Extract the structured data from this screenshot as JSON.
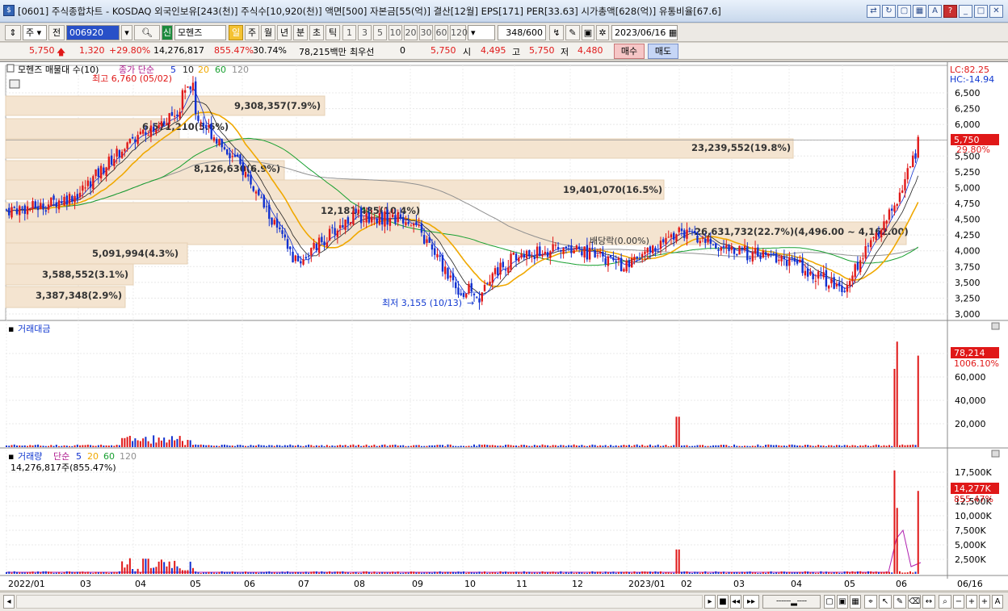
{
  "window": {
    "title": "[0601] 주식종합차트 - KOSDAQ 외국인보유[243(천)] 주식수[10,920(천)] 액면[500] 자본금[55(억)] 결산[12월] EPS[171] PER[33.63] 시가총액[628(억)] 유통비율[67.6]"
  },
  "toolbar": {
    "period_main": "주",
    "prev_label": "전",
    "code": "006920",
    "badge": "신",
    "stock_name": "모헨즈",
    "period_tabs": [
      "일",
      "주",
      "월",
      "년",
      "분",
      "초",
      "틱"
    ],
    "minutes": [
      "1",
      "3",
      "5",
      "10",
      "20",
      "30",
      "60",
      "120"
    ],
    "count": "348",
    "count_total": "/600",
    "date": "2023/06/16"
  },
  "quote": {
    "price": "5,750",
    "change": "1,320",
    "change_pct": "+29.80%",
    "volume": "14,276,817",
    "volume_ratio": "855.47%",
    "turnover": "30.74%",
    "amount": "78,215백만",
    "best_label": "최우선",
    "best_value": "0",
    "ask": "5,750",
    "open_label": "시",
    "open": "4,495",
    "high_label": "고",
    "high": "5,750",
    "low_label": "저",
    "low": "4,480",
    "buy_label": "매수",
    "sell_label": "매도"
  },
  "price_panel": {
    "legend_name": "모헨즈 매물대 수(10)",
    "ma_label": "종가 단순",
    "ma_periods": [
      "5",
      "10",
      "20",
      "60",
      "120"
    ],
    "lc": "LC:82.25",
    "hc": "HC:-14.94",
    "cur_price": "5,750",
    "cur_pct": "29.80%",
    "high_note": "최고 6,760 (05/02)",
    "low_note": "최저 3,155 (10/13)",
    "dividend_note": "배당락(0.00%)",
    "y_ticks": [
      "6,500",
      "6,250",
      "6,000",
      "5,750",
      "5,500",
      "5,250",
      "5,000",
      "4,750",
      "4,500",
      "4,250",
      "4,000",
      "3,750",
      "3,500",
      "3,250",
      "3,000"
    ],
    "profile": [
      {
        "label": "9,308,357(7.9%)"
      },
      {
        "label": "6,571,210(5.6%)"
      },
      {
        "label": "23,239,552(19.8%)"
      },
      {
        "label": "8,126,630(6.9%)"
      },
      {
        "label": "19,401,070(16.5%)"
      },
      {
        "label": "12,181,485(10.4%)"
      },
      {
        "label": "26,631,732(22.7%)(4,496.00 ~ 4,162.00)"
      },
      {
        "label": "5,091,994(4.3%)"
      },
      {
        "label": "3,588,552(3.1%)"
      },
      {
        "label": "3,387,348(2.9%)"
      }
    ]
  },
  "amount_panel": {
    "label": "거래대금",
    "cur_value": "78,214",
    "cur_pct": "1006.10%",
    "y_ticks": [
      "80,000",
      "60,000",
      "40,000",
      "20,000"
    ]
  },
  "volume_panel": {
    "label": "거래량",
    "ma_label": "단순",
    "ma_periods": [
      "5",
      "20",
      "60",
      "120"
    ],
    "sub": "14,276,817주(855.47%)",
    "cur_value": "14,277K",
    "cur_pct": "855.47%",
    "y_ticks": [
      "17,500K",
      "15,000K",
      "12,500K",
      "10,000K",
      "7,500K",
      "5,000K",
      "2,500K"
    ]
  },
  "xaxis": {
    "labels": [
      "2022/01",
      "03",
      "04",
      "05",
      "06",
      "07",
      "08",
      "09",
      "10",
      "11",
      "12",
      "2023/01",
      "02",
      "03",
      "04",
      "05",
      "06"
    ],
    "right_label": "06/16"
  },
  "colors": {
    "up": "#e01818",
    "down": "#1030d0",
    "ma5": "#1030d0",
    "ma10": "#222222",
    "ma20": "#f0a800",
    "ma60": "#18a030",
    "ma120": "#909090",
    "profile": "#f4e4d0"
  },
  "chart_data": {
    "type": "candlestick",
    "price_range": [
      3000,
      6760
    ],
    "price_samples": [
      {
        "x": "2022/01",
        "y": 4650
      },
      {
        "x": "02",
        "y": 4700
      },
      {
        "x": "03",
        "y": 4900
      },
      {
        "x": "04",
        "y": 5800
      },
      {
        "x": "05",
        "y": 6300
      },
      {
        "x": "06",
        "y": 5300
      },
      {
        "x": "07",
        "y": 3800
      },
      {
        "x": "08",
        "y": 4550
      },
      {
        "x": "09",
        "y": 4500
      },
      {
        "x": "10",
        "y": 3300
      },
      {
        "x": "11",
        "y": 3900
      },
      {
        "x": "12",
        "y": 4050
      },
      {
        "x": "2023/01",
        "y": 3750
      },
      {
        "x": "02",
        "y": 4300
      },
      {
        "x": "03",
        "y": 4000
      },
      {
        "x": "04",
        "y": 3850
      },
      {
        "x": "05",
        "y": 3400
      },
      {
        "x": "06",
        "y": 4700
      },
      {
        "x": "06/16",
        "y": 5750
      }
    ]
  }
}
